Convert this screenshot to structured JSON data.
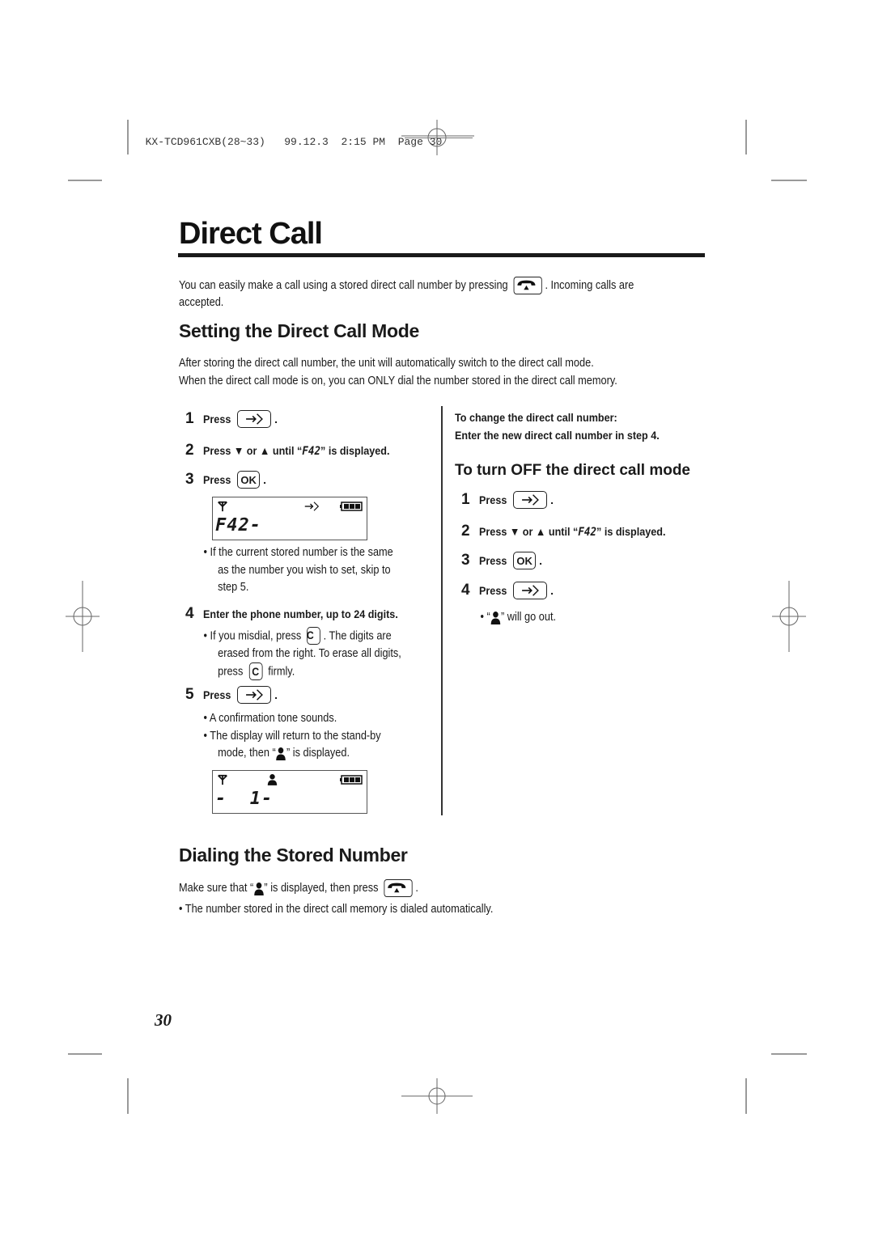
{
  "print_header": {
    "job": "KX-TCD961CXB(28~33)",
    "date": "99.12.3",
    "time": "2:15 PM",
    "page_label": "Page 30"
  },
  "title": "Direct Call",
  "intro": {
    "before_icon": "You can easily make a call using a stored direct call number by pressing",
    "after_icon": ". Incoming calls are",
    "line2": "accepted."
  },
  "setting_section": {
    "heading": "Setting the Direct Call Mode",
    "para1": "After storing the direct call number, the unit will automatically switch to the direct call mode.",
    "para2": "When the direct call mode is on, you can ONLY dial the number stored in the direct call memory.",
    "steps": [
      {
        "num": "1",
        "text": "Press",
        "key": "direct-call-key",
        "end": "."
      },
      {
        "num": "2",
        "text_a": "Press ▼ or ▲ until “",
        "code": "F42",
        "text_b": "” is displayed."
      },
      {
        "num": "3",
        "text": "Press",
        "key_label": "OK",
        "end": "."
      },
      {
        "num": "4",
        "text": "Enter the phone number, up to 24 digits."
      },
      {
        "num": "5",
        "text": "Press",
        "key": "direct-call-key",
        "end": "."
      }
    ],
    "lcd1": {
      "code": "F42-",
      "icons": [
        "antenna-icon",
        "direct-call-icon",
        "battery-icon"
      ]
    },
    "note_step3": [
      "• If the current stored number is the same",
      "as the number you wish to set, skip to",
      "step 5."
    ],
    "note_step4": {
      "a": "• If you misdial, press",
      "key_label": "C",
      "b": ". The digits are",
      "line2": "erased from the right. To erase all digits,",
      "line3_a": "press",
      "line3_b": "firmly."
    },
    "note_step5": {
      "b1": "• A confirmation tone sounds.",
      "b2": "• The display will return to the stand-by",
      "b3_a": "mode, then “",
      "b3_b": "” is displayed."
    },
    "lcd2": {
      "code": "-  1-",
      "icons": [
        "antenna-icon",
        "person-icon",
        "battery-icon"
      ]
    }
  },
  "change_note": {
    "line1": "To change the direct call number:",
    "line2": "Enter the new direct call number in step 4."
  },
  "turn_off_section": {
    "heading": "To turn OFF the direct call mode",
    "steps": [
      {
        "num": "1",
        "text": "Press",
        "end": "."
      },
      {
        "num": "2",
        "text_a": "Press ▼ or ▲ until “",
        "code": "F42",
        "text_b": "” is displayed."
      },
      {
        "num": "3",
        "text": "Press",
        "key_label": "OK",
        "end": "."
      },
      {
        "num": "4",
        "text": "Press",
        "end": "."
      }
    ],
    "note_a": "• “",
    "note_b": "” will go out."
  },
  "dialing_section": {
    "heading": "Dialing the Stored Number",
    "line_a": "Make sure that “",
    "line_b": "” is displayed, then press",
    "line_c": ".",
    "bullet": "• The number stored in the direct call memory is dialed automatically."
  },
  "page_number": "30"
}
